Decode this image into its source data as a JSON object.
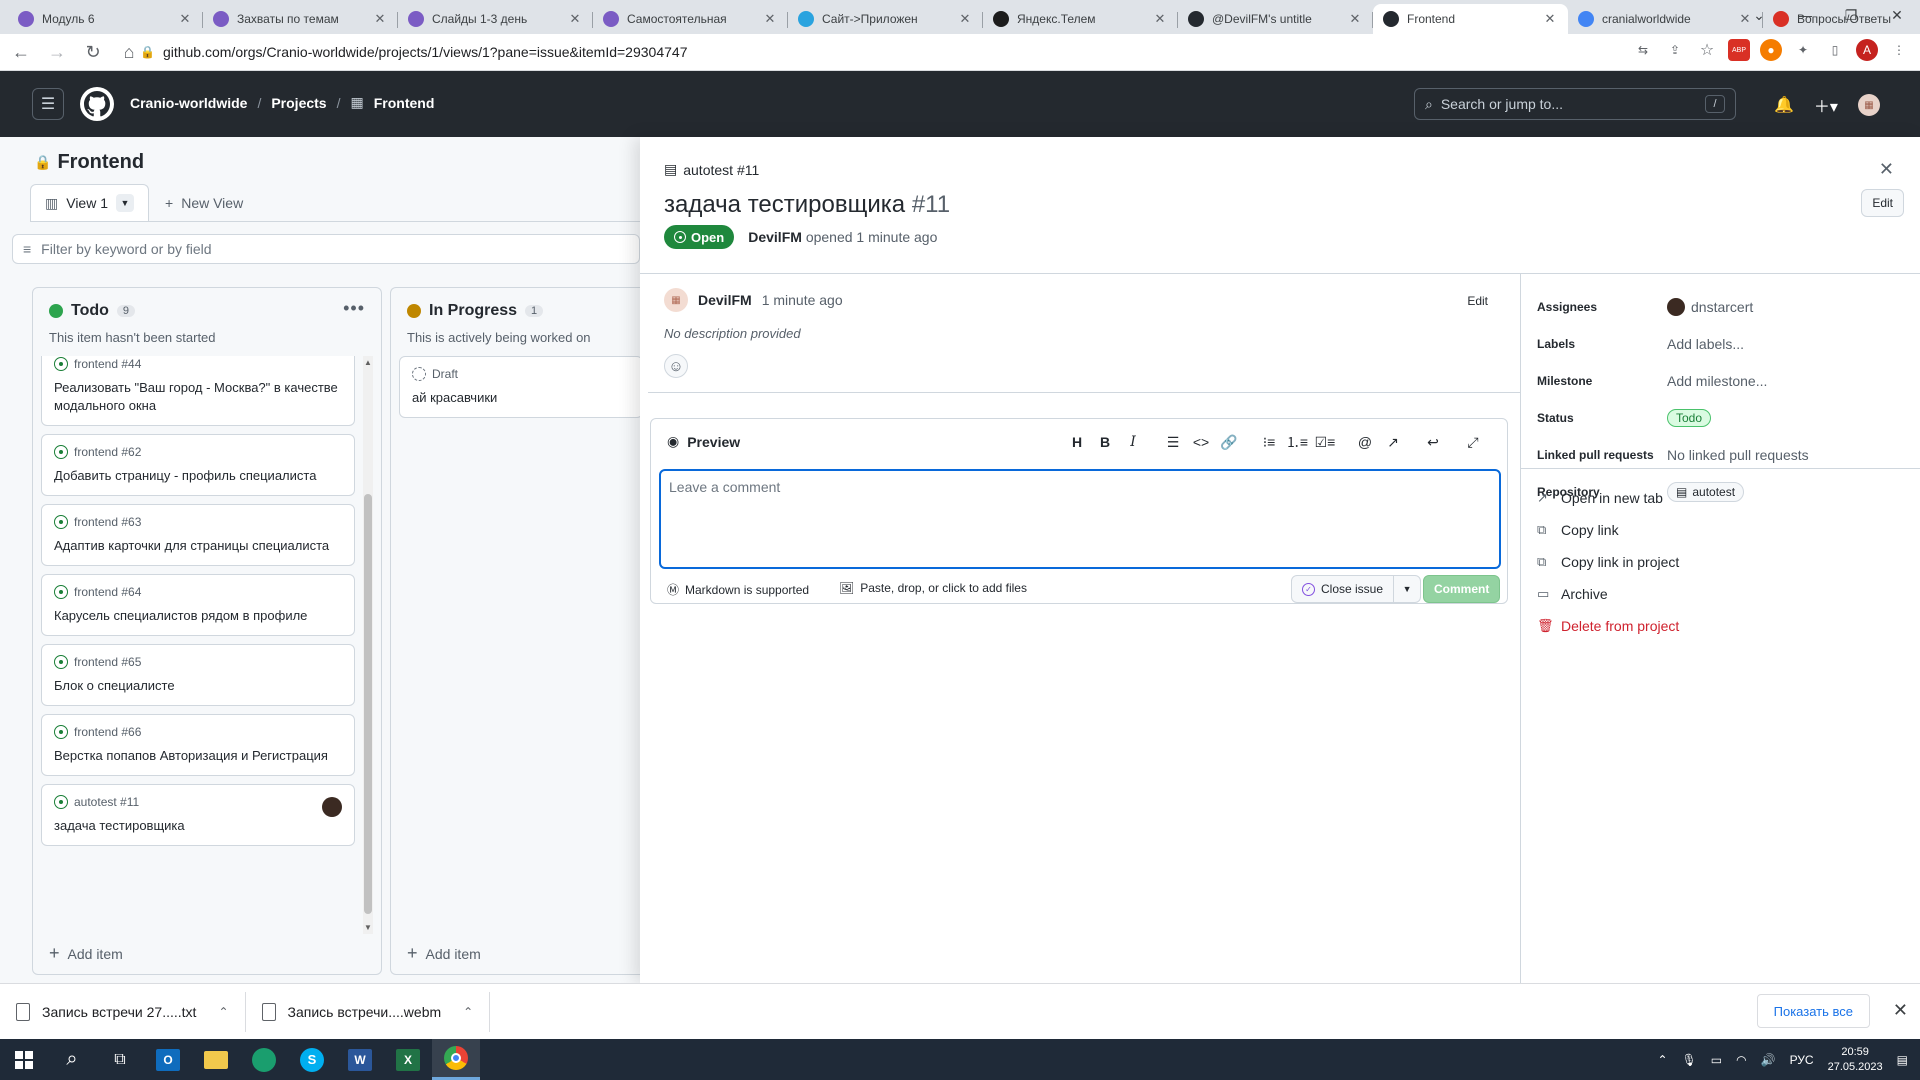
{
  "browser": {
    "tabs": [
      {
        "title": "Модуль 6",
        "icon": "purple-feather-icon",
        "color": "#7b5cc4",
        "active": false
      },
      {
        "title": "Захваты по темам",
        "icon": "purple-feather-icon",
        "color": "#7b5cc4",
        "active": false
      },
      {
        "title": "Слайды 1-3 день",
        "icon": "purple-feather-icon",
        "color": "#7b5cc4",
        "active": false
      },
      {
        "title": "Самостоятельная",
        "icon": "purple-feather-icon",
        "color": "#7b5cc4",
        "active": false
      },
      {
        "title": "Сайт->Приложен",
        "icon": "telegram-icon",
        "color": "#2aa3df",
        "active": false
      },
      {
        "title": "Яндекс.Телем",
        "icon": "yandex-telemost-icon",
        "color": "#1c1c1c",
        "active": false
      },
      {
        "title": "@DevilFM's untitle",
        "icon": "github-icon",
        "color": "#24292f",
        "active": false
      },
      {
        "title": "Frontend",
        "icon": "github-icon",
        "color": "#24292f",
        "active": true
      },
      {
        "title": "cranialworldwide",
        "icon": "google-icon",
        "color": "#4285f4",
        "active": false
      },
      {
        "title": "Вопросы/Ответы",
        "icon": "red-headphones-icon",
        "color": "#d93025",
        "active": false
      }
    ],
    "url": "github.com/orgs/Cranio-worldwide/projects/1/views/1?pane=issue&itemId=29304747",
    "profile_initial": "A",
    "abp_label": "ABP"
  },
  "github": {
    "breadcrumbs": [
      "Cranio-worldwide",
      "Projects",
      "Frontend"
    ],
    "search_placeholder": "Search or jump to...",
    "search_kbd": "/"
  },
  "project": {
    "title": "Frontend",
    "view_tab": "View 1",
    "new_view": "New View",
    "filter_placeholder": "Filter by keyword or by field",
    "columns": [
      {
        "name": "Todo",
        "count": "9",
        "color": "#2da44e",
        "subtitle": "This item hasn't been started",
        "cards": [
          {
            "meta": "frontend #44",
            "title": "Реализовать \"Ваш город - Москва?\" в качестве модального окна"
          },
          {
            "meta": "frontend #62",
            "title": "Добавить страницу - профиль специалиста"
          },
          {
            "meta": "frontend #63",
            "title": "Адаптив карточки для страницы специалиста"
          },
          {
            "meta": "frontend #64",
            "title": "Карусель специалистов рядом в профиле"
          },
          {
            "meta": "frontend #65",
            "title": "Блок о специалисте"
          },
          {
            "meta": "frontend #66",
            "title": "Верстка попапов Авторизация и Регистрация"
          },
          {
            "meta": "autotest #11",
            "title": "задача тестировщика",
            "has_avatar": true
          }
        ],
        "add_item": "Add item"
      },
      {
        "name": "In Progress",
        "count": "1",
        "color": "#bf8700",
        "subtitle": "This is actively being worked on",
        "cards": [
          {
            "meta": "Draft",
            "title": "ай красавчики",
            "draft": true
          }
        ],
        "add_item": "Add item"
      }
    ]
  },
  "issue": {
    "repo_ref": "autotest #11",
    "title": "задача тестировщика",
    "number": "#11",
    "edit_label": "Edit",
    "state": "Open",
    "author": "DevilFM",
    "opened_text": "opened 1 minute ago",
    "comment": {
      "author": "DevilFM",
      "time": "1 minute ago",
      "edit": "Edit",
      "body": "No description provided"
    },
    "editor": {
      "preview_label": "Preview",
      "placeholder": "Leave a comment",
      "markdown_note": "Markdown is supported",
      "paste_note": "Paste, drop, or click to add files",
      "close_issue": "Close issue",
      "comment_btn": "Comment"
    },
    "sidebar": {
      "assignees_label": "Assignees",
      "assignee": "dnstarcert",
      "labels_label": "Labels",
      "labels_value": "Add labels...",
      "milestone_label": "Milestone",
      "milestone_value": "Add milestone...",
      "status_label": "Status",
      "status_value": "Todo",
      "linked_label": "Linked pull requests",
      "linked_value": "No linked pull requests",
      "repo_label": "Repository",
      "repo_value": "autotest"
    },
    "actions": {
      "open_tab": "Open in new tab",
      "copy_link": "Copy link",
      "copy_link_project": "Copy link in project",
      "archive": "Archive",
      "delete": "Delete from project"
    }
  },
  "downloads": {
    "items": [
      "Запись встречи 27.....txt",
      "Запись встречи....webm"
    ],
    "show_all": "Показать все"
  },
  "taskbar": {
    "lang": "РУС",
    "time": "20:59",
    "date": "27.05.2023"
  }
}
